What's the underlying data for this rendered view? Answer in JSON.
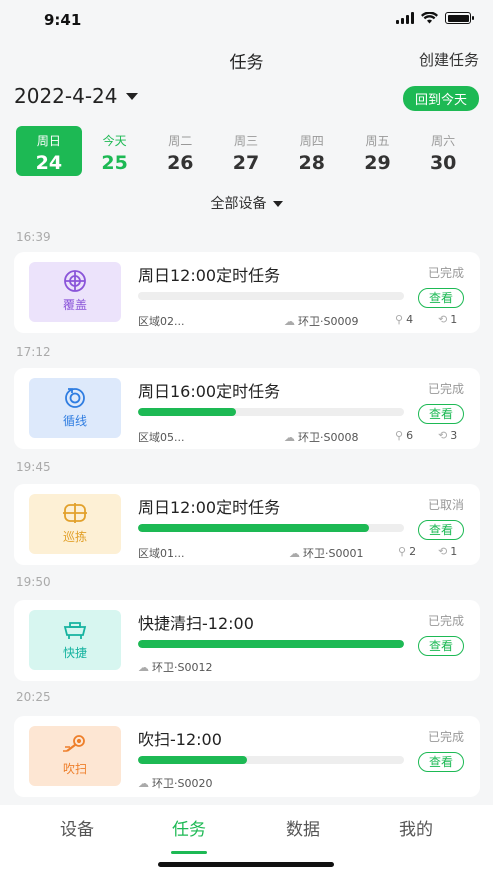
{
  "status_bar": {
    "time": "9:41"
  },
  "header": {
    "title": "任务",
    "action": "创建任务"
  },
  "date_selector": {
    "date": "2022-4-24",
    "today_button": "回到今天"
  },
  "week": [
    {
      "weekday": "周日",
      "day": "24",
      "state": "selected"
    },
    {
      "weekday": "今天",
      "day": "25",
      "state": "today"
    },
    {
      "weekday": "周二",
      "day": "26",
      "state": ""
    },
    {
      "weekday": "周三",
      "day": "27",
      "state": ""
    },
    {
      "weekday": "周四",
      "day": "28",
      "state": ""
    },
    {
      "weekday": "周五",
      "day": "29",
      "state": ""
    },
    {
      "weekday": "周六",
      "day": "30",
      "state": ""
    }
  ],
  "filter": {
    "label": "全部设备"
  },
  "tasks": [
    {
      "time": "16:39",
      "type": "覆盖",
      "icon": "grid-circle-icon",
      "color": "#8a55d9",
      "bg": "#ece3fb",
      "title": "周日12:00定时任务",
      "status": "已完成",
      "view": "查看",
      "progress": 0.0,
      "area": "区域02...",
      "device": "环卫·S0009",
      "points": "4",
      "loops": "1"
    },
    {
      "time": "17:12",
      "type": "循线",
      "icon": "loop-icon",
      "color": "#2f7de1",
      "bg": "#dde9fb",
      "title": "周日16:00定时任务",
      "status": "已完成",
      "view": "查看",
      "progress": 0.37,
      "area": "区域05...",
      "device": "环卫·S0008",
      "points": "6",
      "loops": "3"
    },
    {
      "time": "19:45",
      "type": "巡拣",
      "icon": "patrol-icon",
      "color": "#e2a12b",
      "bg": "#fdf0d5",
      "title": "周日12:00定时任务",
      "status": "已取消",
      "view": "查看",
      "progress": 0.87,
      "area": "区域01...",
      "device": "环卫·S0001",
      "points": "2",
      "loops": "1"
    },
    {
      "time": "19:50",
      "type": "快捷",
      "icon": "sweeper-icon",
      "color": "#16b3a0",
      "bg": "#d7f6f0",
      "title": "快捷清扫-12:00",
      "status": "已完成",
      "view": "查看",
      "progress": 1.0,
      "area": "",
      "device": "环卫·S0012",
      "points": "",
      "loops": ""
    },
    {
      "time": "20:25",
      "type": "吹扫",
      "icon": "blower-icon",
      "color": "#ee7f2b",
      "bg": "#fde6d3",
      "title": "吹扫-12:00",
      "status": "已完成",
      "view": "查看",
      "progress": 0.41,
      "area": "",
      "device": "环卫·S0020",
      "points": "",
      "loops": ""
    }
  ],
  "tabs": [
    "设备",
    "任务",
    "数据",
    "我的"
  ],
  "active_tab": 1
}
